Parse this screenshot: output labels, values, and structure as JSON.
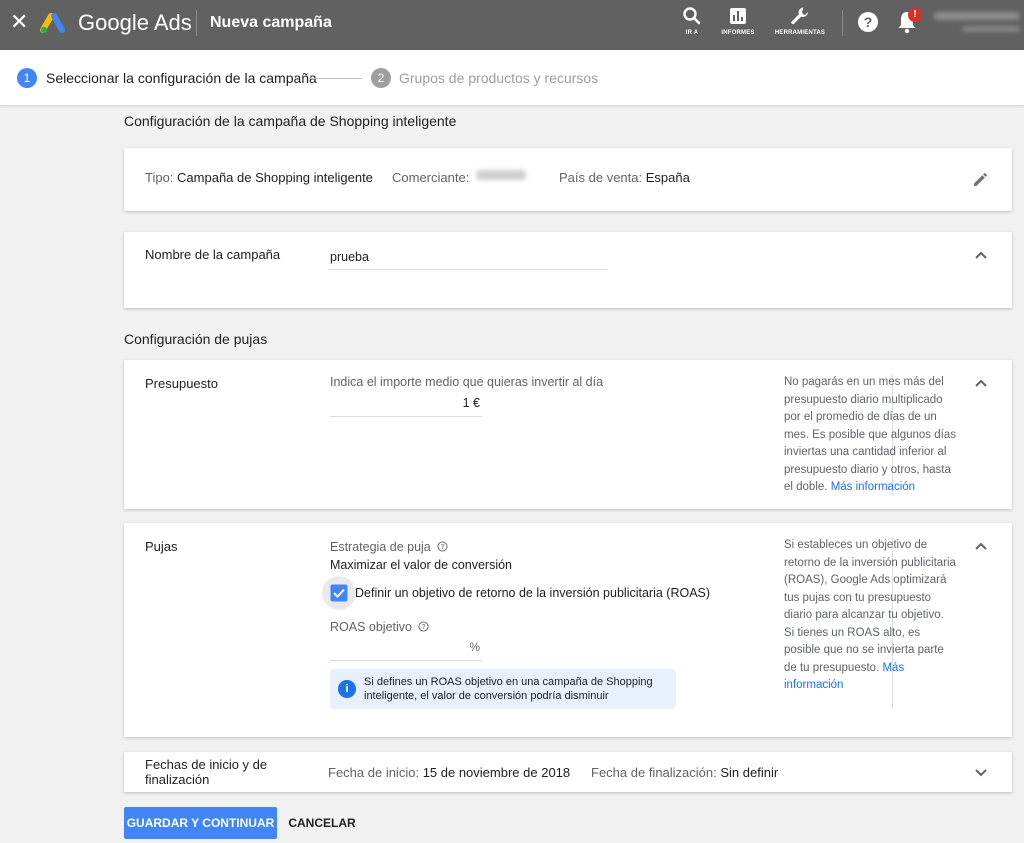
{
  "topbar": {
    "close_icon": "close-icon",
    "brand": "Google Ads",
    "page_title": "Nueva campaña",
    "tools": [
      {
        "label": "IR A",
        "icon": "search-icon"
      },
      {
        "label": "INFORMES",
        "icon": "bar-chart-icon"
      },
      {
        "label": "HERRAMIENTAS",
        "icon": "wrench-icon"
      }
    ],
    "notification_badge": "!"
  },
  "stepper": {
    "steps": [
      {
        "number": "1",
        "label": "Seleccionar la configuración de la campaña",
        "active": true
      },
      {
        "number": "2",
        "label": "Grupos de productos y recursos",
        "active": false
      }
    ]
  },
  "campaign_settings": {
    "title": "Configuración de la campaña de Shopping inteligente",
    "summary": {
      "type_label": "Tipo:",
      "type_value": "Campaña de Shopping inteligente",
      "merchant_label": "Comerciante:",
      "country_label": "País de venta:",
      "country_value": "España"
    },
    "name": {
      "label": "Nombre de la campaña",
      "value": "prueba"
    }
  },
  "bidding": {
    "title": "Configuración de pujas",
    "budget": {
      "label": "Presupuesto",
      "field_label": "Indica el importe medio que quieras invertir al día",
      "value": "1 €",
      "help": "No pagarás en un mes más del presupuesto diario multiplicado por el promedio de días de un mes. Es posible que algunos días inviertas una cantidad inferior al presupuesto diario y otros, hasta el doble.",
      "help_link": "Más información"
    },
    "bids": {
      "label": "Pujas",
      "strategy_label": "Estrategia de puja",
      "strategy_value": "Maximizar el valor de conversión",
      "roas_checkbox_label": "Definir un objetivo de retorno de la inversión publicitaria (ROAS)",
      "roas_checked": true,
      "roas_label": "ROAS objetivo",
      "roas_unit": "%",
      "info": "Si defines un ROAS objetivo en una campaña de Shopping inteligente, el valor de conversión podría disminuir",
      "help": "Si estableces un objetivo de retorno de la inversión publicitaria (ROAS), Google Ads optimizará tus pujas con tu presupuesto diario para alcanzar tu objetivo. Si tienes un ROAS alto, es posible que no se invierta parte de tu presupuesto.",
      "help_link": "Más información"
    },
    "dates": {
      "label": "Fechas de inicio y de finalización",
      "start_label": "Fecha de inicio:",
      "start_value": "15 de noviembre de 2018",
      "end_label": "Fecha de finalización:",
      "end_value": "Sin definir"
    }
  },
  "actions": {
    "save": "GUARDAR Y CONTINUAR",
    "cancel": "CANCELAR"
  },
  "colors": {
    "topbar": "#616161",
    "accent": "#4285f4",
    "link": "#1a73e8"
  }
}
